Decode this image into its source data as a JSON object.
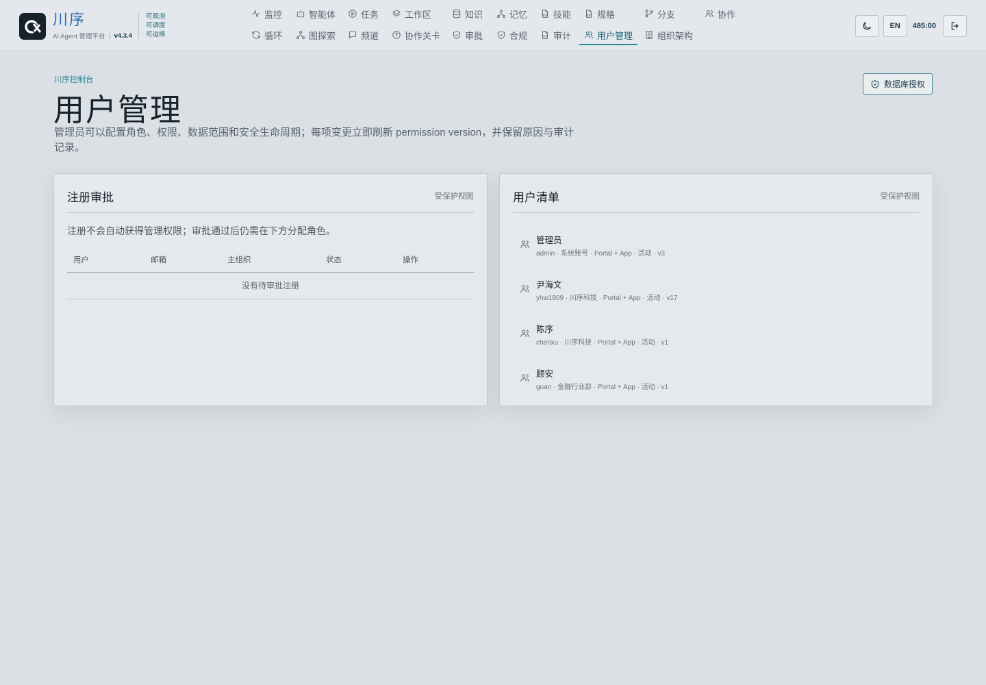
{
  "brand": {
    "name": "川序",
    "subtitle": "AI Agent 管理平台",
    "version": "v4.3.4",
    "tags": [
      "可观测",
      "可调度",
      "可运维"
    ]
  },
  "nav": {
    "row1": [
      {
        "label": "监控",
        "icon": "activity-icon"
      },
      {
        "label": "智能体",
        "icon": "bot-icon"
      },
      {
        "label": "任务",
        "icon": "play-circle-icon"
      },
      {
        "label": "工作区",
        "icon": "layers-icon"
      },
      {
        "label": "知识",
        "icon": "database-icon"
      },
      {
        "label": "记忆",
        "icon": "network-icon"
      },
      {
        "label": "技能",
        "icon": "file-code-icon"
      },
      {
        "label": "规格",
        "icon": "file-code-icon"
      },
      {
        "label": "分支",
        "icon": "git-branch-icon"
      },
      {
        "label": "协作",
        "icon": "users-icon"
      }
    ],
    "row2": [
      {
        "label": "循环",
        "icon": "refresh-icon"
      },
      {
        "label": "图探索",
        "icon": "network-icon"
      },
      {
        "label": "频道",
        "icon": "message-square-icon"
      },
      {
        "label": "协作关卡",
        "icon": "help-circle-icon"
      },
      {
        "label": "审批",
        "icon": "shield-check-icon"
      },
      {
        "label": "合规",
        "icon": "shield-check-icon"
      },
      {
        "label": "审计",
        "icon": "file-code-icon"
      },
      {
        "label": "用户管理",
        "icon": "users-icon"
      },
      {
        "label": "组织架构",
        "icon": "building-icon"
      }
    ],
    "active": "用户管理"
  },
  "topright": {
    "theme_icon": "moon-icon",
    "lang_label": "EN",
    "timer": "485:00",
    "logout_icon": "logout-icon"
  },
  "page": {
    "crumb": "川序控制台",
    "title": "用户管理",
    "description": "管理员可以配置角色、权限、数据范围和安全生命周期；每项变更立即刷新 permission version，并保留原因与审计记录。",
    "db_button": "数据库授权"
  },
  "registration": {
    "title": "注册审批",
    "tag": "受保护视图",
    "note": "注册不会自动获得管理权限；审批通过后仍需在下方分配角色。",
    "columns": [
      "用户",
      "邮箱",
      "主组织",
      "状态",
      "操作"
    ],
    "empty": "没有待审批注册"
  },
  "users": {
    "title": "用户清单",
    "tag": "受保护视图",
    "items": [
      {
        "name": "管理员",
        "meta": "admin · 系统账号 · Portal + App · 活动 · v3"
      },
      {
        "name": "尹海文",
        "meta": "yhw1809 · 川序科技 · Portal + App · 活动 · v17"
      },
      {
        "name": "陈序",
        "meta": "chenxu · 川序科技 · Portal + App · 活动 · v1"
      },
      {
        "name": "顾安",
        "meta": "guan · 金融行业部 · Portal + App · 活动 · v1"
      }
    ]
  },
  "colors": {
    "accent": "#2b8796",
    "brand": "#2b6fb3",
    "background": "#dbe0e4",
    "panel": "#e5e9ec"
  }
}
